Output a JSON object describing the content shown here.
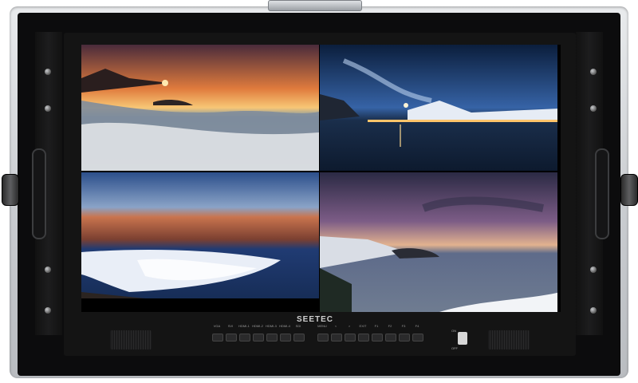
{
  "brand": "SEETEC",
  "controls": {
    "source_buttons": [
      "VGA",
      "SVI",
      "HDMI-1",
      "HDMI-2",
      "HDMI-3",
      "HDMI-4",
      "SDI"
    ],
    "menu_buttons": [
      "MENU",
      "<",
      ">",
      "EXIT",
      "F1",
      "F2",
      "F3",
      "F4"
    ]
  },
  "power_switch": {
    "on_label": "ON",
    "off_label": "OFF"
  },
  "screen_quads": [
    {
      "name": "sunset-coast",
      "colors": [
        "#f28f3b",
        "#3b6d9b",
        "#d8d4d0"
      ]
    },
    {
      "name": "night-harbor",
      "colors": [
        "#0b2342",
        "#355f9c",
        "#ffcc73"
      ]
    },
    {
      "name": "salt-flat-valley",
      "colors": [
        "#1f3f7a",
        "#b24b2d",
        "#dfe5f2"
      ]
    },
    {
      "name": "crater-lake-dusk",
      "colors": [
        "#45385a",
        "#7f5a8c",
        "#e7c7a0"
      ]
    }
  ]
}
